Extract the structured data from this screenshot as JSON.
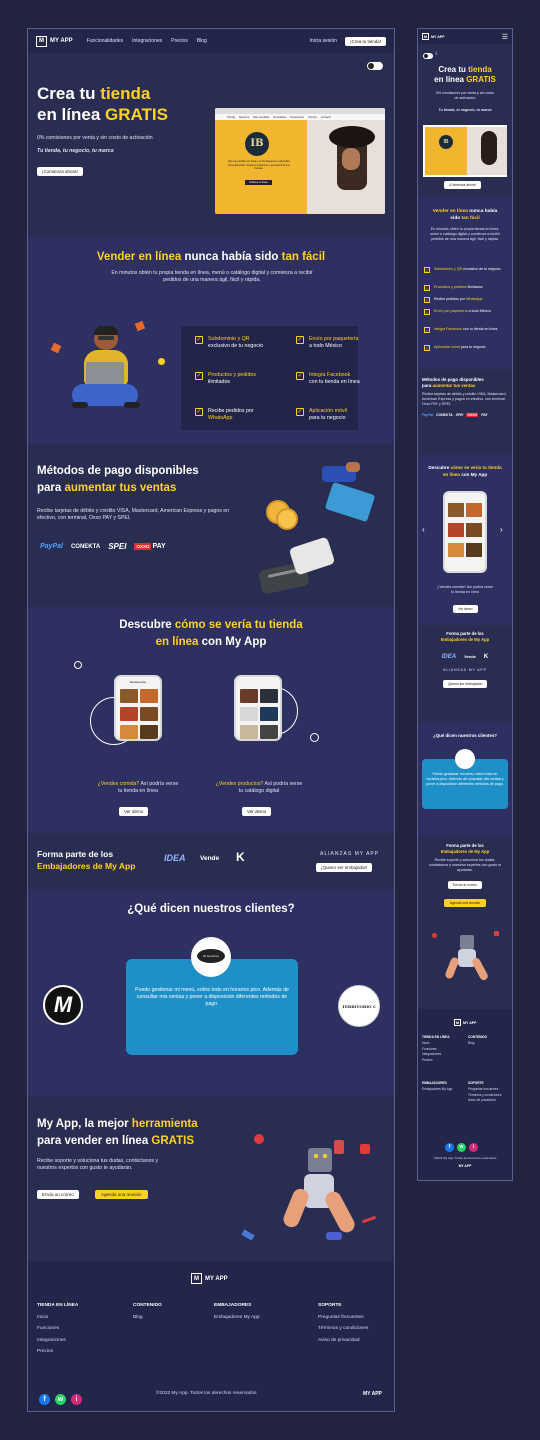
{
  "brand": "MY APP",
  "logo_mark": "M",
  "nav": {
    "links": [
      "Funcionalidades",
      "Integraciones",
      "Precios",
      "Blog"
    ],
    "login": "Inicia sesión",
    "cta": "¡Crea tu tienda!"
  },
  "theme_toggle": {
    "light": "●",
    "dark": "☾"
  },
  "hero": {
    "title_1": "Crea tu ",
    "title_y1": "tienda",
    "title_2": "en línea ",
    "title_y2": "GRATIS",
    "sub": "0% comisiones por venta y sin costo de activación",
    "tagline": "Tu tienda, tu negocio, tu marca",
    "cta": "¡Comienza ahora!",
    "shop_logo": "IB",
    "shop_tabs": [
      "Tienda",
      "Nosotros",
      "Más vendidos",
      "Novedades",
      "Descuentos",
      "Precios",
      "Contacto"
    ],
    "shop_text": "Haz tus pedidos en línea y te los llevamos a domicilio. Consulta todos nuestros productos y encuentra lo que buscas.",
    "shop_btn": "Ordena en línea"
  },
  "sell": {
    "title_1": "Vender en línea ",
    "title_2": "nunca había sido ",
    "title_y": "tan fácil",
    "desc": "En minutos obtén tu propia tienda en línea, menú o catálogo digital y comienza a recibir pedidos de una manera ágil, fácil y rápida.",
    "features": [
      {
        "y": "Subdominio y QR",
        "rest": "exclusivo de tu negocio"
      },
      {
        "y": "Envío por paquetería",
        "rest": "a todo México"
      },
      {
        "y": "Productos y pedidos",
        "rest": "ilimitados"
      },
      {
        "y": "Integra Facebook",
        "rest": "con tu tienda en línea"
      },
      {
        "pre": "Recibe pedidos por",
        "y": "WhatsApp",
        "rest": ""
      },
      {
        "y": "Aplicación móvil",
        "rest": "para tu negocio"
      }
    ]
  },
  "payments": {
    "title_1": "Métodos de pago disponibles",
    "title_2": "para ",
    "title_y": "aumentar tus ventas",
    "desc": "Recibe tarjetas de débito y crédito VISA, Mastercard, American Express y pagos en efectivo, con terminal, Oxxo PAY y SPEI.",
    "logos": [
      "PayPal",
      "CONEKTA",
      "SPEI",
      "OXXO",
      "PAY"
    ]
  },
  "discover": {
    "title_1": "Descubre ",
    "title_y1": "cómo se vería tu tienda",
    "title_y2": "en línea",
    "title_2": " con My App",
    "card1_y": "¿Vendes comida?",
    "card1_rest": " Así podría verse tu tienda en línea",
    "card2_y": "¿Vendes productos?",
    "card2_rest": " Así podría verse tu catálogo digital",
    "btn": "Ver demo",
    "phone_header": "Restaurante"
  },
  "ambassadors": {
    "title_1": "Forma parte de los",
    "title_y": "Embajadores de My App",
    "alliances": "ALIANZAS MY APP",
    "cta": "¡Quiero ser embajador!",
    "partners": [
      "IDEA",
      "Vende",
      "K"
    ]
  },
  "testimonials": {
    "title": "¿Qué dicen nuestros clientes?",
    "quote": "Puedo gestionar mi menú, sobre todo en horarios pico. Además de consultar mis ventas y poner a disposición diferentes métodos de pago.",
    "badge": "El Gourmet",
    "left_logo": "M",
    "right_logo": "TERRITORIO C"
  },
  "best": {
    "title_1": "My App, la mejor ",
    "title_y1": "herramienta",
    "title_2": "para vender en línea ",
    "title_y2": "GRATIS",
    "desc": "Recibe soporte y soluciona tus dudas, contáctanos y nuestros expertos con gusto te ayudarán.",
    "btn_mail": "Envía un correo",
    "btn_meet": "Agenda una reunión"
  },
  "footer": {
    "cols": [
      {
        "title": "TIENDA EN LÍNEA",
        "items": [
          "Inicio",
          "Funciones",
          "Integraciones",
          "Precios"
        ]
      },
      {
        "title": "CONTENIDO",
        "items": [
          "Blog"
        ]
      },
      {
        "title": "EMBAJADORES",
        "items": [
          "Embajadores My App"
        ]
      },
      {
        "title": "SOPORTE",
        "items": [
          "Preguntas frecuentes",
          "Términos y condiciones",
          "Aviso de privacidad"
        ]
      }
    ],
    "copy": "©2022 My App. Todos los derechos reservados",
    "brand_right": "MY APP",
    "social": [
      "f",
      "w",
      "i"
    ]
  },
  "mobile": {
    "menu_icon": "☰",
    "arrows": [
      "‹",
      "›"
    ],
    "discover_card": "¿Vendes comida? Así podría verse tu tienda en línea",
    "sell_title_1": "Vender en línea",
    "sell_title_2": " nunca había",
    "sell_title_3": "sido ",
    "sell_title_y": "tan fácil"
  },
  "colors": {
    "bg": "#2a2d52",
    "accent": "#ffd21f",
    "nav": "#23264a",
    "quote": "#1f8fc7"
  }
}
